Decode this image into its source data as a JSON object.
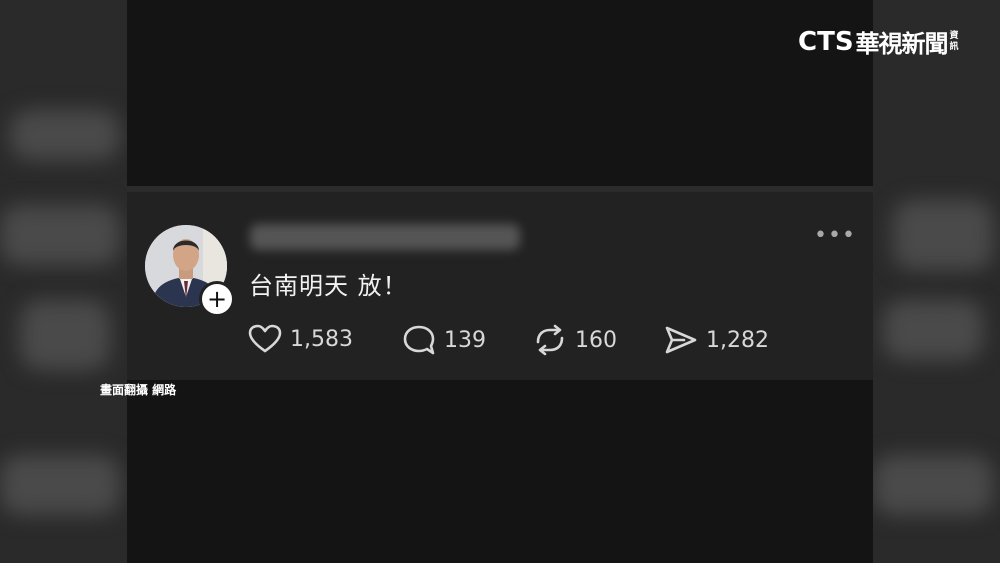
{
  "logo": {
    "en": "CTS",
    "zh": "華視新聞",
    "small_top": "資",
    "small_bottom": "訊"
  },
  "post": {
    "text": "台南明天 放！",
    "menu_label": "•••",
    "actions": {
      "likes": "1,583",
      "comments": "139",
      "reposts": "160",
      "shares": "1,282"
    }
  },
  "credit": "畫面翻攝 網路",
  "icons": [
    "plus-icon",
    "more-icon",
    "heart-icon",
    "comment-icon",
    "repost-icon",
    "share-icon"
  ]
}
